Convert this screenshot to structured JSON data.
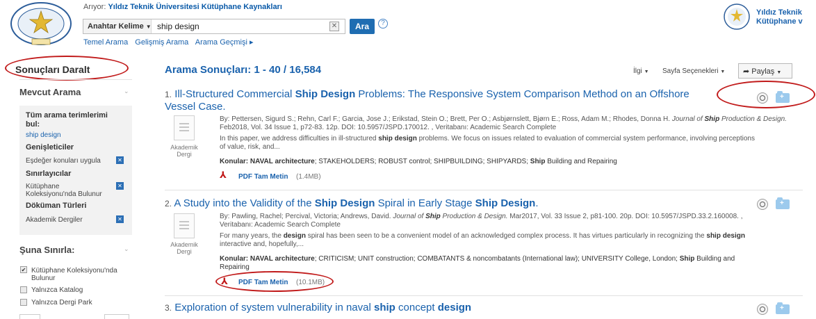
{
  "header": {
    "searching_prefix": "Arıyor:",
    "searching_db": "Yıldız Teknik Üniversitesi Kütüphane Kaynakları",
    "field_select": "Anahtar Kelime",
    "query": "ship design",
    "search_button": "Ara",
    "help": "?",
    "nav": [
      "Temel Arama",
      "Gelişmiş Arama",
      "Arama Geçmişi ▸"
    ],
    "institution_line1": "Yıldız Teknik",
    "institution_line2": "Kütüphane v",
    "logo_text_top": "TEKNİK ÜNİVERSİTESİ",
    "logo_year": "1911"
  },
  "sidebar": {
    "refine_title": "Sonuçları Daralt",
    "current_search_head": "Mevcut Arama",
    "all_terms": "Tüm arama terimlerimi bul:",
    "query_link": "ship design",
    "expanders_head": "Genişleticiler",
    "expander_item": "Eşdeğer konuları uygula",
    "limiters_head": "Sınırlayıcılar",
    "limiter_item": "Kütüphane Koleksiyonu'nda Bulunur",
    "doc_types_head": "Döküman Türleri",
    "doc_type_item": "Akademik Dergiler",
    "limit_to_head": "Şuna Sınırla:",
    "checkboxes": [
      {
        "label": "Kütüphane Koleksiyonu'nda Bulunur",
        "checked": true
      },
      {
        "label": "Yalnızca Katalog",
        "checked": false
      },
      {
        "label": "Yalnızca Dergi Park",
        "checked": false
      }
    ]
  },
  "results": {
    "heading": "Arama Sonuçları: 1 - 40 / 16,584",
    "sort": "İlgi",
    "page_options": "Sayfa Seçenekleri",
    "share": "Paylaş",
    "doc_type": "Akademik Dergi",
    "items": [
      {
        "num": "1.",
        "title_a": "Ill-Structured Commercial ",
        "title_b": "Ship Design",
        "title_c": " Problems: The Responsive System Comparison Method on an Offshore",
        "title_d": "Vessel Case.",
        "authors": "By: Pettersen, Sigurd S.; Rehn, Carl F.; Garcia, Jose J.; Erikstad, Stein O.; Brett, Per O.; Asbjørnslett, Bjørn E.; Ross, Adam M.; Rhodes, Donna H.",
        "journal_a": "Journal of",
        "journal_b": "Ship",
        "journal_c": "Production",
        "journal_d": "& Design.",
        "source": " Feb2018, Vol. 34 Issue 1, p72-83. 12p. DOI: 10.5957/JSPD.170012. , Veritabanı: Academic Search Complete",
        "abstract_a": "In this paper, we address difficulties in ill-structured ",
        "abstract_b": "ship design",
        "abstract_c": " problems. We focus on issues related to evaluation of commercial system performance, involving perceptions",
        "abstract_d": "of value, risk, and...",
        "subjects_label": "Konular:",
        "subjects_a": "NAVAL architecture",
        "subjects_b": "; STAKEHOLDERS; ROBUST control; SHIPBUILDING; SHIPYARDS; ",
        "subjects_c": "Ship",
        "subjects_d": " Building and Repairing",
        "pdf_label": "PDF Tam Metin",
        "pdf_size": "(1.4MB)"
      },
      {
        "num": "2.",
        "title_a": "A Study into the Validity of the ",
        "title_b": "Ship Design",
        "title_c": " Spiral in Early Stage ",
        "title_d": "Ship Design",
        "title_e": ".",
        "authors_a": "By: Pawling, Rachel; Percival, Victoria; Andrews, David.",
        "journal_a": "Journal of",
        "journal_b": "Ship",
        "journal_c": "Production & Design.",
        "source": " Mar2017, Vol. 33 Issue 2, p81-100. 20p. DOI: 10.5957/JSPD.33.2.160008. ,",
        "db": "Veritabanı: Academic Search Complete",
        "abstract_a": "For many years, the ",
        "abstract_b": "design",
        "abstract_c": " spiral has been seen to be a convenient model of an acknowledged complex process. It has virtues particularly in recognizing the ",
        "abstract_d": "ship design",
        "abstract_e": "interactive and, hopefully,...",
        "subjects_label": "Konular:",
        "subjects_a": "NAVAL architecture",
        "subjects_b": "; CRITICISM; UNIT construction; COMBATANTS & noncombatants (International law); UNIVERSITY College, London; ",
        "subjects_c": "Ship",
        "subjects_d": " Building and",
        "subjects_e": "Repairing",
        "pdf_label": "PDF Tam Metin",
        "pdf_size": "(10.1MB)"
      },
      {
        "num": "3.",
        "title_a": "Exploration of system vulnerability in naval ",
        "title_b": "ship",
        "title_c": " concept ",
        "title_d": "design"
      }
    ]
  },
  "colors": {
    "link": "#1a62ad",
    "annotation": "#c11a1a",
    "button": "#1f6db2"
  }
}
